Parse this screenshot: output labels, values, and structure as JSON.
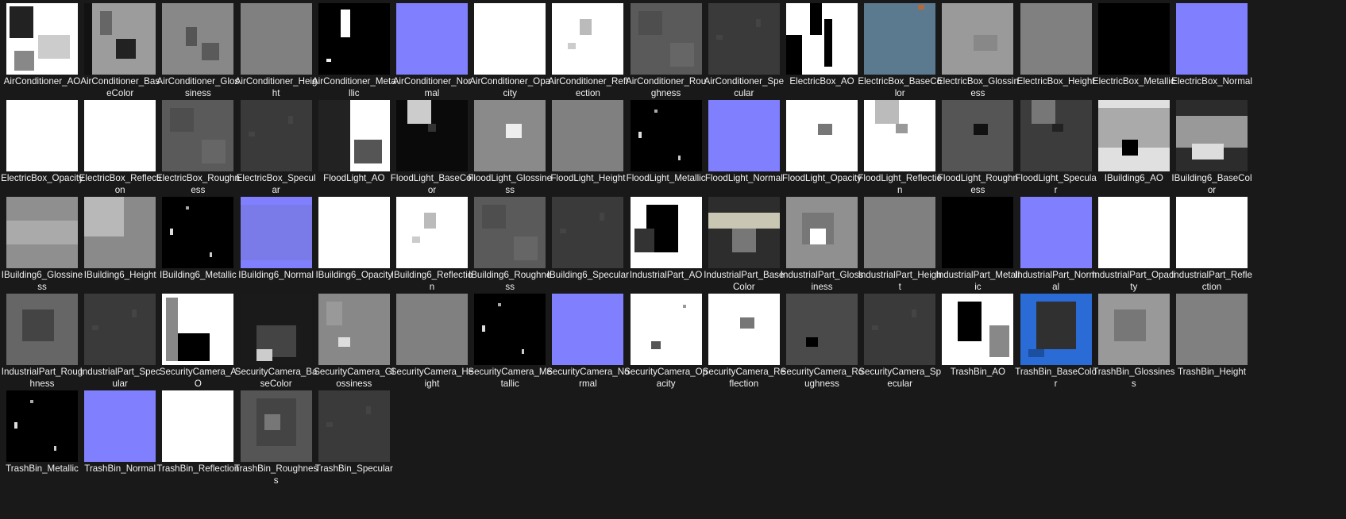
{
  "files": [
    {
      "name": "AirConditioner_AO",
      "tex": "ao-ac"
    },
    {
      "name": "AirConditioner_BaseColor",
      "tex": "base-ac"
    },
    {
      "name": "AirConditioner_Glossiness",
      "tex": "gloss-ac"
    },
    {
      "name": "AirConditioner_Height",
      "tex": "height"
    },
    {
      "name": "AirConditioner_Metallic",
      "tex": "metal-ac"
    },
    {
      "name": "AirConditioner_Normal",
      "tex": "normal"
    },
    {
      "name": "AirConditioner_Opacity",
      "tex": "white"
    },
    {
      "name": "AirConditioner_Reflection",
      "tex": "refl"
    },
    {
      "name": "AirConditioner_Roughness",
      "tex": "rough"
    },
    {
      "name": "AirConditioner_Specular",
      "tex": "spec"
    },
    {
      "name": "ElectricBox_AO",
      "tex": "ao-eb"
    },
    {
      "name": "ElectricBox_BaseColor",
      "tex": "base-eb"
    },
    {
      "name": "ElectricBox_Glossiness",
      "tex": "gloss-eb"
    },
    {
      "name": "ElectricBox_Height",
      "tex": "height"
    },
    {
      "name": "ElectricBox_Metallic",
      "tex": "black"
    },
    {
      "name": "ElectricBox_Normal",
      "tex": "normal"
    },
    {
      "name": "ElectricBox_Opacity",
      "tex": "white"
    },
    {
      "name": "ElectricBox_Reflection",
      "tex": "white"
    },
    {
      "name": "ElectricBox_Roughness",
      "tex": "rough"
    },
    {
      "name": "ElectricBox_Specular",
      "tex": "spec"
    },
    {
      "name": "FloodLight_AO",
      "tex": "ao-fl"
    },
    {
      "name": "FloodLight_BaseColor",
      "tex": "base-fl"
    },
    {
      "name": "FloodLight_Glossiness",
      "tex": "gloss-fl"
    },
    {
      "name": "FloodLight_Height",
      "tex": "height"
    },
    {
      "name": "FloodLight_Metallic",
      "tex": "black-spots"
    },
    {
      "name": "FloodLight_Normal",
      "tex": "normal"
    },
    {
      "name": "FloodLight_Opacity",
      "tex": "white-box"
    },
    {
      "name": "FloodLight_Reflection",
      "tex": "refl-fl"
    },
    {
      "name": "FloodLight_Roughness",
      "tex": "rough-fl"
    },
    {
      "name": "FloodLight_Specular",
      "tex": "spec-fl"
    },
    {
      "name": "IBuilding6_AO",
      "tex": "ao-ib"
    },
    {
      "name": "IBuilding6_BaseColor",
      "tex": "base-ib"
    },
    {
      "name": "IBuilding6_Glossiness",
      "tex": "gloss-ib"
    },
    {
      "name": "IBuilding6_Height",
      "tex": "height-ib"
    },
    {
      "name": "IBuilding6_Metallic",
      "tex": "black-spots"
    },
    {
      "name": "IBuilding6_Normal",
      "tex": "normal-ib"
    },
    {
      "name": "IBuilding6_Opacity",
      "tex": "white"
    },
    {
      "name": "IBuilding6_Reflection",
      "tex": "refl"
    },
    {
      "name": "IBuilding6_Roughness",
      "tex": "rough"
    },
    {
      "name": "IBuilding6_Specular",
      "tex": "spec"
    },
    {
      "name": "IndustrialPart_AO",
      "tex": "ao-ip"
    },
    {
      "name": "IndustrialPart_BaseColor",
      "tex": "base-ip"
    },
    {
      "name": "IndustrialPart_Glossiness",
      "tex": "gloss-ip"
    },
    {
      "name": "IndustrialPart_Height",
      "tex": "height"
    },
    {
      "name": "IndustrialPart_Metallic",
      "tex": "black"
    },
    {
      "name": "IndustrialPart_Normal",
      "tex": "normal"
    },
    {
      "name": "IndustrialPart_Opacity",
      "tex": "white"
    },
    {
      "name": "IndustrialPart_Reflection",
      "tex": "white"
    },
    {
      "name": "IndustrialPart_Roughness",
      "tex": "rough-ip"
    },
    {
      "name": "IndustrialPart_Specular",
      "tex": "spec"
    },
    {
      "name": "SecurityCamera_AO",
      "tex": "ao-sc"
    },
    {
      "name": "SecurityCamera_BaseColor",
      "tex": "base-sc"
    },
    {
      "name": "SecurityCamera_Glossiness",
      "tex": "gloss-sc"
    },
    {
      "name": "SecurityCamera_Height",
      "tex": "height"
    },
    {
      "name": "SecurityCamera_Metallic",
      "tex": "black-spots"
    },
    {
      "name": "SecurityCamera_Normal",
      "tex": "normal"
    },
    {
      "name": "SecurityCamera_Opacity",
      "tex": "white-dark"
    },
    {
      "name": "SecurityCamera_Reflection",
      "tex": "white-box"
    },
    {
      "name": "SecurityCamera_Roughness",
      "tex": "rough-sc"
    },
    {
      "name": "SecurityCamera_Specular",
      "tex": "spec"
    },
    {
      "name": "TrashBin_AO",
      "tex": "ao-tb"
    },
    {
      "name": "TrashBin_BaseColor",
      "tex": "base-tb"
    },
    {
      "name": "TrashBin_Glossiness",
      "tex": "gloss-tb"
    },
    {
      "name": "TrashBin_Height",
      "tex": "height"
    },
    {
      "name": "TrashBin_Metallic",
      "tex": "black-spots"
    },
    {
      "name": "TrashBin_Normal",
      "tex": "normal"
    },
    {
      "name": "TrashBin_Reflection",
      "tex": "white"
    },
    {
      "name": "TrashBin_Roughness",
      "tex": "rough-tb"
    },
    {
      "name": "TrashBin_Specular",
      "tex": "spec"
    }
  ],
  "colors": {
    "background": "#191919",
    "normal_map": "#8080ff",
    "label_text": "#ffffff"
  }
}
